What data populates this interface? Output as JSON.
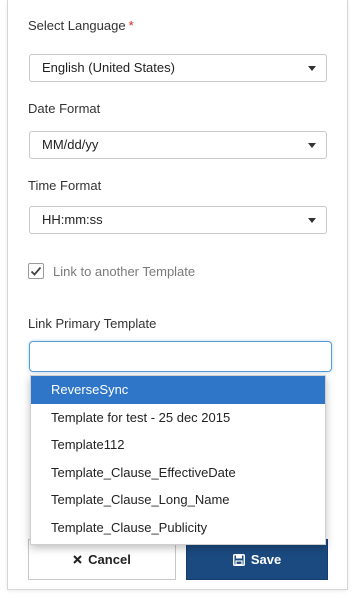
{
  "language": {
    "label": "Select Language",
    "required_mark": "*",
    "value": "English (United States)"
  },
  "date_format": {
    "label": "Date Format",
    "value": "MM/dd/yy"
  },
  "time_format": {
    "label": "Time Format",
    "value": "HH:mm:ss"
  },
  "link_template": {
    "checkbox_label": "Link to another Template",
    "checked": true
  },
  "primary_template": {
    "label": "Link Primary Template",
    "value": "",
    "options": [
      "ReverseSync",
      "Template for test - 25 dec 2015",
      "Template112",
      "Template_Clause_EffectiveDate",
      "Template_Clause_Long_Name",
      "Template_Clause_Publicity"
    ],
    "highlighted_index": 0
  },
  "actions": {
    "cancel_label": "Cancel",
    "save_label": "Save",
    "cancel_icon": "times-icon",
    "save_icon": "floppy-disk-icon"
  },
  "colors": {
    "required": "#d21e1e",
    "highlight": "#2f76c9",
    "save_button": "#1b4a80",
    "focus_border": "#5b9bd5"
  }
}
